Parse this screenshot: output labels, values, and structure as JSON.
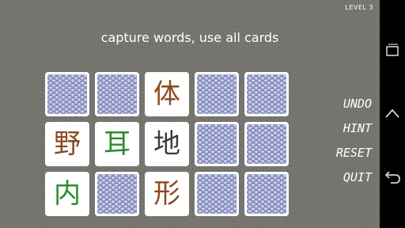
{
  "game": {
    "level": "LEVEL 3",
    "instructions": "capture words, use all cards",
    "cards": [
      {
        "row": 0,
        "col": 0,
        "state": "back",
        "char": "",
        "color": ""
      },
      {
        "row": 0,
        "col": 1,
        "state": "back",
        "char": "",
        "color": ""
      },
      {
        "row": 0,
        "col": 2,
        "state": "face",
        "char": "体",
        "color": "#8a4a1e"
      },
      {
        "row": 0,
        "col": 3,
        "state": "back",
        "char": "",
        "color": ""
      },
      {
        "row": 0,
        "col": 4,
        "state": "back",
        "char": "",
        "color": ""
      },
      {
        "row": 1,
        "col": 0,
        "state": "face",
        "char": "野",
        "color": "#8a4a1e"
      },
      {
        "row": 1,
        "col": 1,
        "state": "face",
        "char": "耳",
        "color": "#2e8b2e"
      },
      {
        "row": 1,
        "col": 2,
        "state": "face",
        "char": "地",
        "color": "#3a3a3a"
      },
      {
        "row": 1,
        "col": 3,
        "state": "back",
        "char": "",
        "color": ""
      },
      {
        "row": 1,
        "col": 4,
        "state": "back",
        "char": "",
        "color": ""
      },
      {
        "row": 2,
        "col": 0,
        "state": "face",
        "char": "内",
        "color": "#2e8b2e"
      },
      {
        "row": 2,
        "col": 1,
        "state": "back",
        "char": "",
        "color": ""
      },
      {
        "row": 2,
        "col": 2,
        "state": "face",
        "char": "形",
        "color": "#8a4a1e"
      },
      {
        "row": 2,
        "col": 3,
        "state": "back",
        "char": "",
        "color": ""
      },
      {
        "row": 2,
        "col": 4,
        "state": "back",
        "char": "",
        "color": ""
      }
    ]
  },
  "menu": {
    "undo": "UNDO",
    "hint": "HINT",
    "reset": "RESET",
    "quit": "QUIT"
  },
  "navbar": {
    "recents_icon": "recents-icon",
    "home_icon": "home-icon",
    "back_icon": "back-icon"
  },
  "colors": {
    "background": "#74736d",
    "card_back_pattern": "#6f78b5",
    "navbar": "#000000"
  }
}
